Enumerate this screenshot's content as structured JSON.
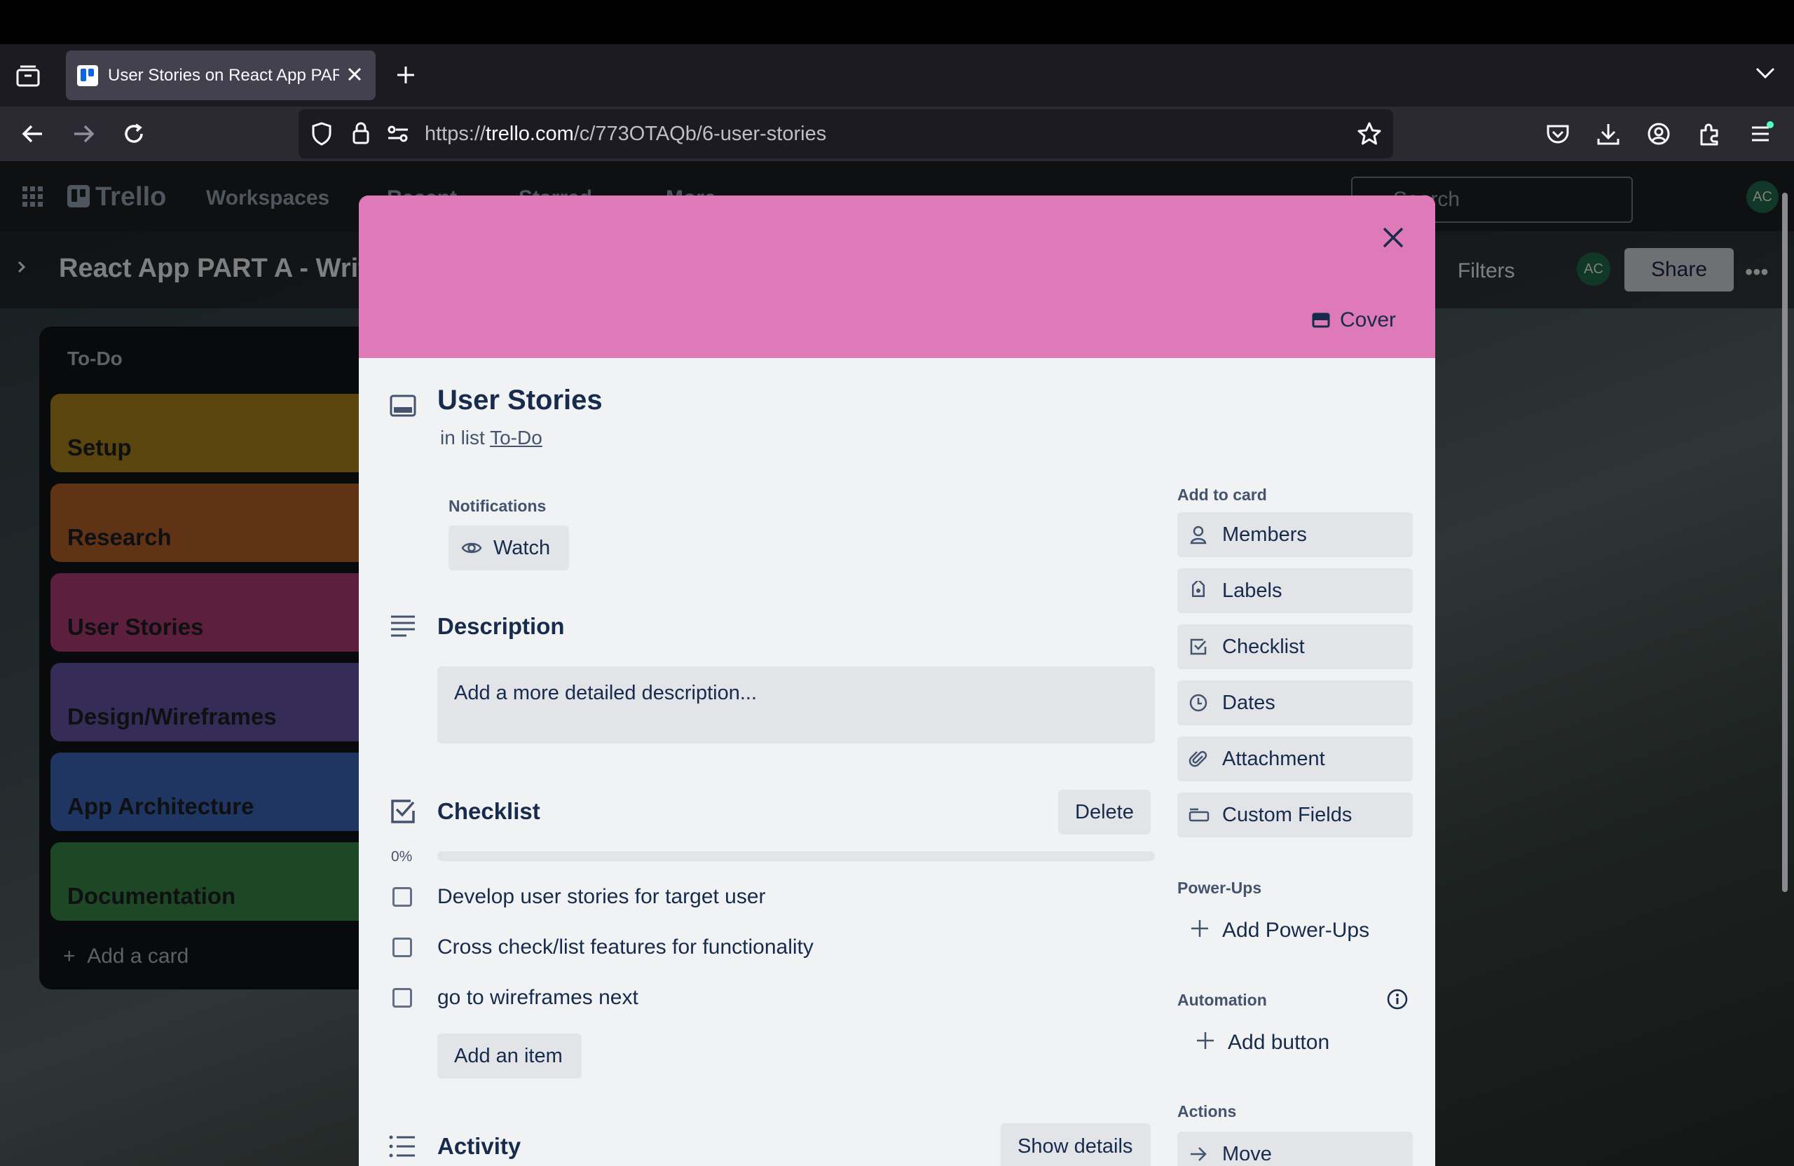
{
  "browser": {
    "tab_title": "User Stories on React App PART A",
    "url_prefix": "https://",
    "url_host": "trello.com",
    "url_path": "/c/773OTAQb/6-user-stories"
  },
  "trello": {
    "logo": "Trello",
    "nav": [
      "Workspaces",
      "Recent",
      "Starred",
      "More"
    ],
    "search_placeholder": "Search",
    "avatar": "AC",
    "board_title": "React App PART A - Writ",
    "filters": "Filters",
    "share": "Share",
    "list_title": "To-Do",
    "cards": [
      {
        "label": "Setup",
        "color": "#b38a1a"
      },
      {
        "label": "Research",
        "color": "#c0672a"
      },
      {
        "label": "User Stories",
        "color": "#b83f7a"
      },
      {
        "label": "Design/Wireframes",
        "color": "#6b5ab0"
      },
      {
        "label": "App Architecture",
        "color": "#3f6bc4"
      },
      {
        "label": "Documentation",
        "color": "#3c8f4a"
      }
    ],
    "add_card": "Add a card"
  },
  "modal": {
    "cover_color": "#dd7ab7",
    "cover_label": "Cover",
    "title": "User Stories",
    "in_list_prefix": "in list",
    "in_list_name": "To-Do",
    "notifications_label": "Notifications",
    "watch_label": "Watch",
    "description_heading": "Description",
    "description_placeholder": "Add a more detailed description...",
    "checklist_heading": "Checklist",
    "checklist_delete": "Delete",
    "checklist_progress": "0%",
    "checklist_items": [
      "Develop user stories for target user",
      "Cross check/list features for functionality",
      "go to wireframes next"
    ],
    "add_item": "Add an item",
    "activity_heading": "Activity",
    "show_details": "Show details",
    "add_to_card": "Add to card",
    "side_buttons": [
      "Members",
      "Labels",
      "Checklist",
      "Dates",
      "Attachment",
      "Custom Fields"
    ],
    "powerups_heading": "Power-Ups",
    "add_powerups": "Add Power-Ups",
    "automation_heading": "Automation",
    "add_button": "Add button",
    "actions_heading": "Actions",
    "move": "Move"
  }
}
